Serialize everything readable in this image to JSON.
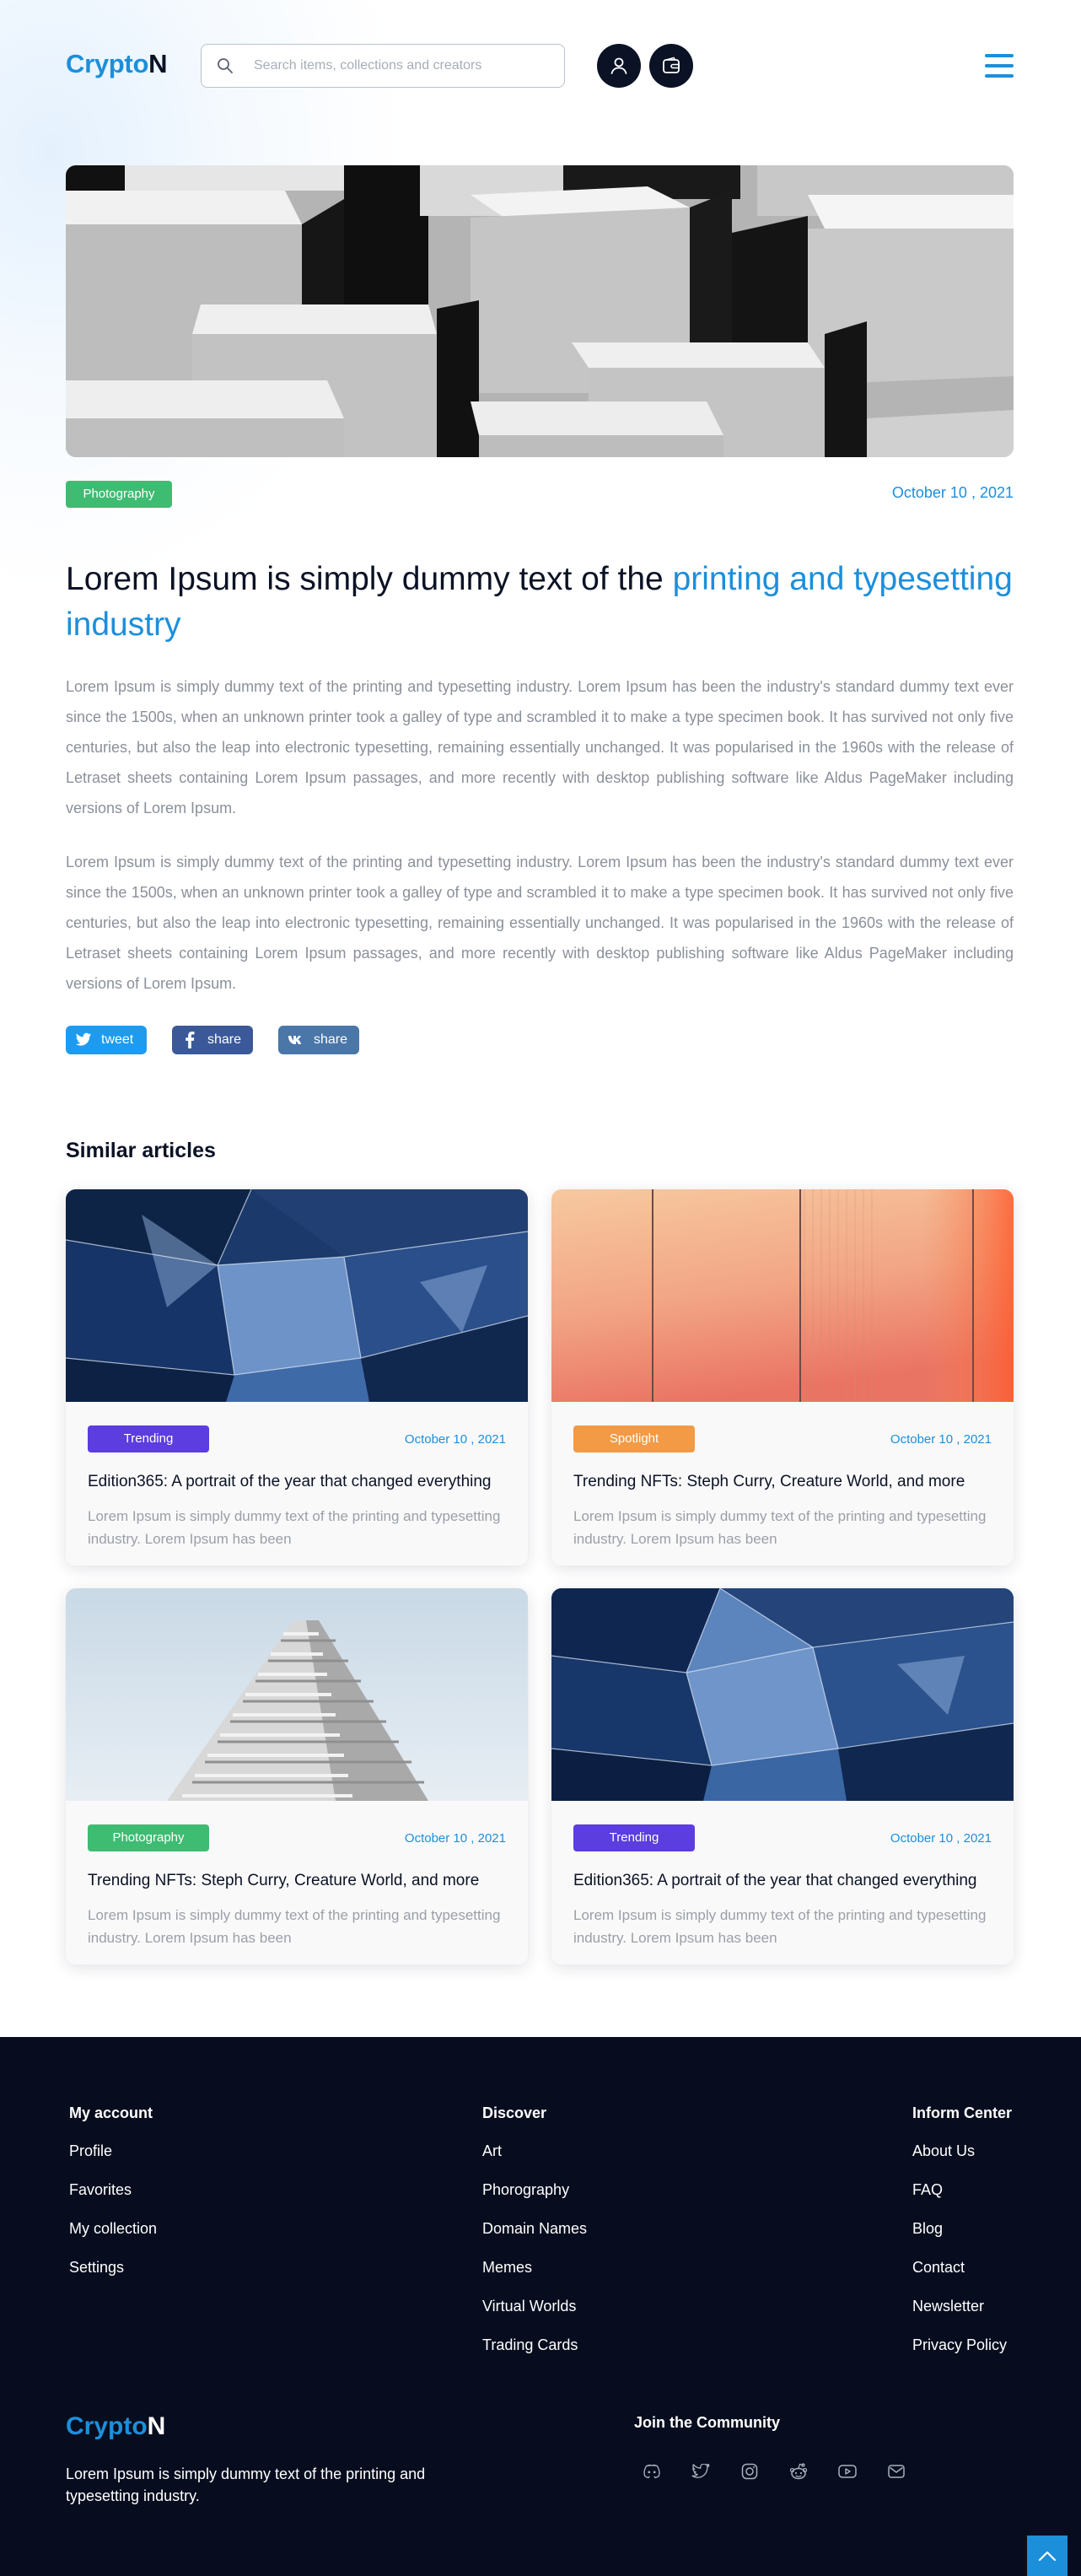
{
  "header": {
    "logo_part1": "Crypto",
    "logo_part2": "N",
    "search_placeholder": "Search items, collections and creators"
  },
  "article": {
    "tag": "Photography",
    "tag_color": "#3ebc72",
    "date": "October 10 , 2021",
    "title_plain": "Lorem Ipsum is simply dummy text of the ",
    "title_highlight": "printing and typesetting industry",
    "paragraphs": [
      "Lorem Ipsum is simply dummy text of the printing and typesetting industry. Lorem Ipsum has been the industry's standard dummy text ever since the 1500s, when an unknown printer took a galley of type and scrambled it to make a type specimen book. It has survived not only five centuries, but also the leap into electronic typesetting, remaining essentially unchanged. It was popularised in the 1960s with the release of Letraset sheets containing Lorem Ipsum passages, and more recently with desktop publishing software like Aldus PageMaker including versions of Lorem Ipsum.",
      "Lorem Ipsum is simply dummy text of the printing and typesetting industry. Lorem Ipsum has been the industry's standard dummy text ever since the 1500s, when an unknown printer took a galley of type and scrambled it to make a type specimen book. It has survived not only five centuries, but also the leap into electronic typesetting, remaining essentially unchanged. It was popularised in the 1960s with the release of Letraset sheets containing Lorem Ipsum passages, and more recently with desktop publishing software like Aldus PageMaker including versions of Lorem Ipsum."
    ],
    "share": {
      "tweet": "tweet",
      "facebook": "share",
      "vk": "share"
    }
  },
  "similar": {
    "heading": "Similar articles",
    "cards": [
      {
        "tag": "Trending",
        "tag_color": "#5b3de0",
        "date": "October 10 , 2021",
        "title": "Edition365: A portrait of the year that changed everything",
        "desc": "Lorem Ipsum is simply dummy text of the printing and typesetting industry. Lorem Ipsum has been"
      },
      {
        "tag": "Spotlight",
        "tag_color": "#f29a45",
        "date": "October 10 , 2021",
        "title": "Trending NFTs: Steph Curry, Creature World, and more",
        "desc": "Lorem Ipsum is simply dummy text of the printing and typesetting industry. Lorem Ipsum has been"
      },
      {
        "tag": "Photography",
        "tag_color": "#3ebc72",
        "date": "October 10 , 2021",
        "title": "Trending NFTs: Steph Curry, Creature World, and more",
        "desc": "Lorem Ipsum is simply dummy text of the printing and typesetting industry. Lorem Ipsum has been"
      },
      {
        "tag": "Trending",
        "tag_color": "#5b3de0",
        "date": "October 10 , 2021",
        "title": "Edition365: A portrait of the year that changed everything",
        "desc": "Lorem Ipsum is simply dummy text of the printing and typesetting industry. Lorem Ipsum has been"
      }
    ]
  },
  "footer": {
    "my_account": {
      "heading": "My account",
      "links": [
        "Profile",
        "Favorites",
        "My collection",
        "Settings"
      ]
    },
    "discover": {
      "heading": "Discover",
      "links": [
        "Art",
        "Phorography",
        "Domain Names",
        "Memes",
        "Virtual Worlds",
        "Trading Cards"
      ]
    },
    "inform": {
      "heading": "Inform Center",
      "links": [
        "About Us",
        "FAQ",
        "Blog",
        "Contact",
        "Newsletter",
        "Privacy Policy"
      ]
    },
    "logo_part1": "Crypto",
    "logo_part2": "N",
    "description": "Lorem Ipsum is simply dummy text of the printing and typesetting industry.",
    "community_heading": "Join the Community",
    "social_icons": [
      "discord-icon",
      "twitter-icon",
      "instagram-icon",
      "reddit-icon",
      "youtube-icon",
      "email-icon"
    ]
  },
  "colors": {
    "accent": "#1c8fdb",
    "dark": "#0b1225",
    "footer_bg": "#070d1e"
  }
}
